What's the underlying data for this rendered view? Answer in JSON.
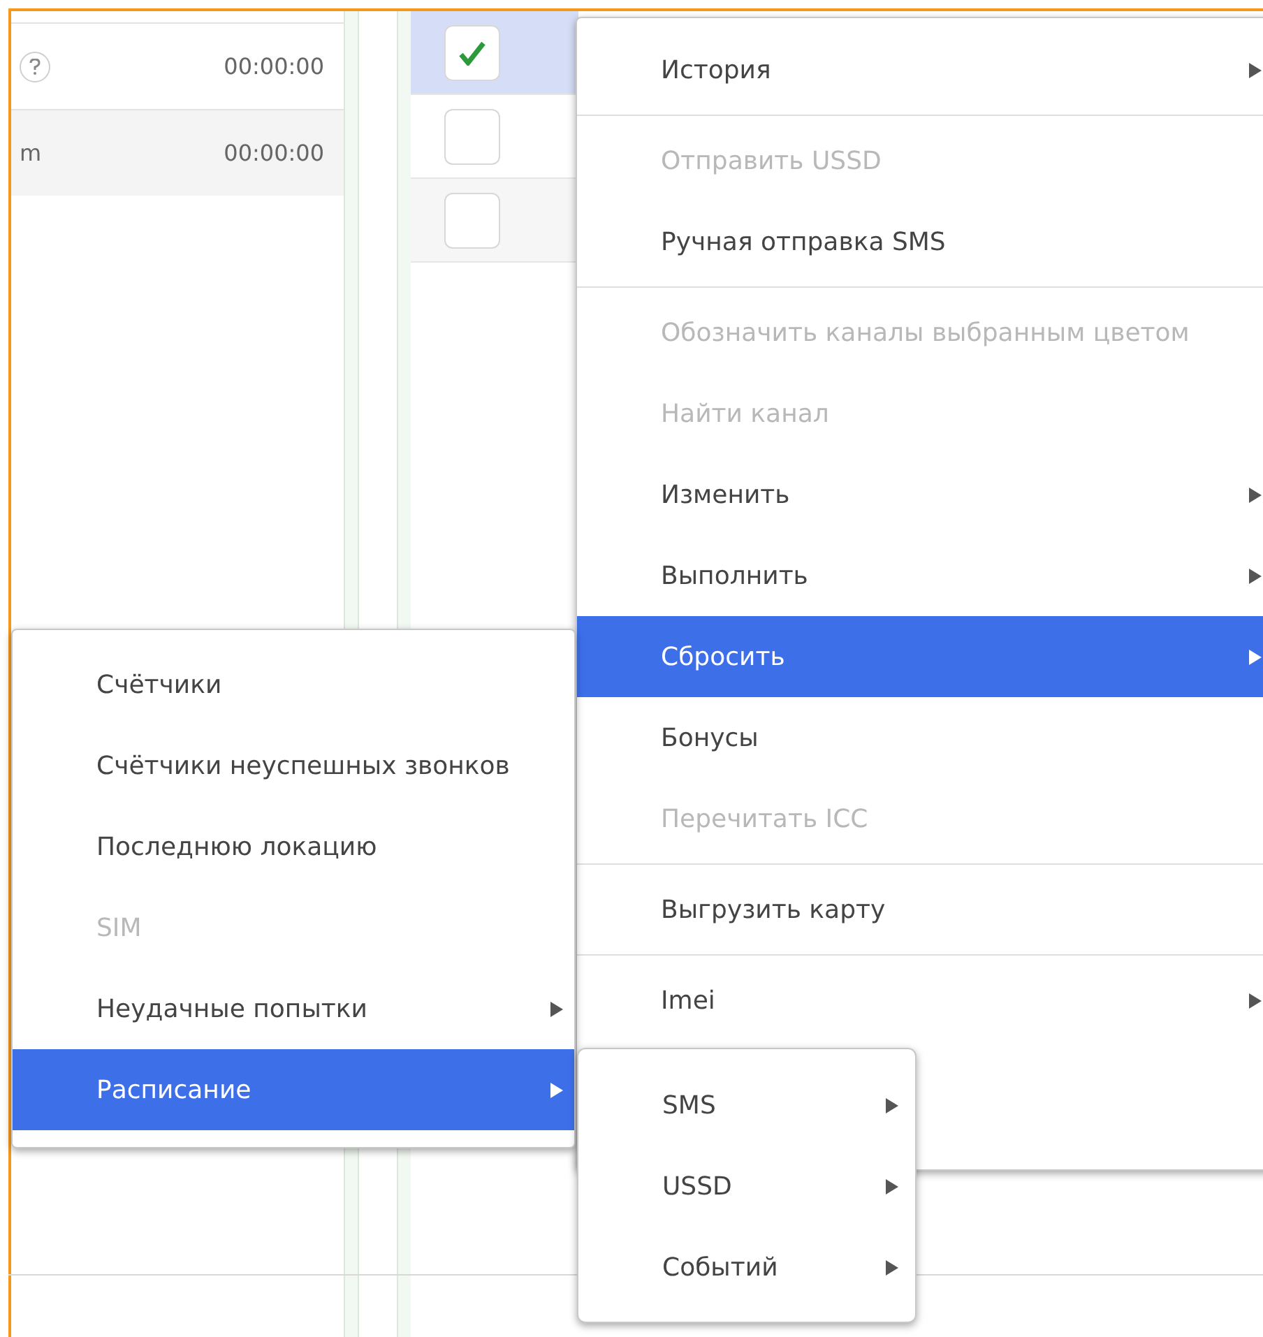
{
  "left_table": {
    "rows": [
      {
        "column_1": "",
        "help": true,
        "time": "00:00:00"
      },
      {
        "column_1": "m",
        "help": false,
        "time": "00:00:00"
      }
    ]
  },
  "right_table": {
    "rows": [
      {
        "checked": true,
        "selected": true
      },
      {
        "checked": false,
        "selected": false
      },
      {
        "checked": false,
        "selected": false
      }
    ]
  },
  "context_menu": {
    "groups": [
      [
        {
          "label": "История",
          "disabled": false,
          "submenu": true,
          "selected": false
        }
      ],
      [
        {
          "label": "Отправить USSD",
          "disabled": true,
          "submenu": false,
          "selected": false
        },
        {
          "label": "Ручная отправка SMS",
          "disabled": false,
          "submenu": false,
          "selected": false
        }
      ],
      [
        {
          "label": "Обозначить каналы выбранным цветом",
          "disabled": true,
          "submenu": false,
          "selected": false
        },
        {
          "label": "Найти канал",
          "disabled": true,
          "submenu": false,
          "selected": false
        },
        {
          "label": "Изменить",
          "disabled": false,
          "submenu": true,
          "selected": false
        },
        {
          "label": "Выполнить",
          "disabled": false,
          "submenu": true,
          "selected": false
        },
        {
          "label": "Сбросить",
          "disabled": false,
          "submenu": true,
          "selected": true
        },
        {
          "label": "Бонусы",
          "disabled": false,
          "submenu": false,
          "selected": false
        },
        {
          "label": "Перечитать ICC",
          "disabled": true,
          "submenu": false,
          "selected": false
        }
      ],
      [
        {
          "label": "Выгрузить карту",
          "disabled": false,
          "submenu": false,
          "selected": false
        }
      ],
      [
        {
          "label": "Imei",
          "disabled": false,
          "submenu": true,
          "selected": false
        }
      ]
    ]
  },
  "reset_submenu": {
    "items": [
      {
        "label": "Счётчики",
        "disabled": false,
        "submenu": false,
        "selected": false
      },
      {
        "label": "Счётчики неуспешных звонков",
        "disabled": false,
        "submenu": false,
        "selected": false
      },
      {
        "label": "Последнюю локацию",
        "disabled": false,
        "submenu": false,
        "selected": false
      },
      {
        "label": "SIM",
        "disabled": true,
        "submenu": false,
        "selected": false
      },
      {
        "label": "Неудачные попытки",
        "disabled": false,
        "submenu": true,
        "selected": false
      },
      {
        "label": "Расписание",
        "disabled": false,
        "submenu": true,
        "selected": true
      }
    ]
  },
  "schedule_submenu": {
    "items": [
      {
        "label": "SMS",
        "disabled": false,
        "submenu": true,
        "selected": false
      },
      {
        "label": "USSD",
        "disabled": false,
        "submenu": true,
        "selected": false
      },
      {
        "label": "Событий",
        "disabled": false,
        "submenu": true,
        "selected": false
      }
    ]
  }
}
